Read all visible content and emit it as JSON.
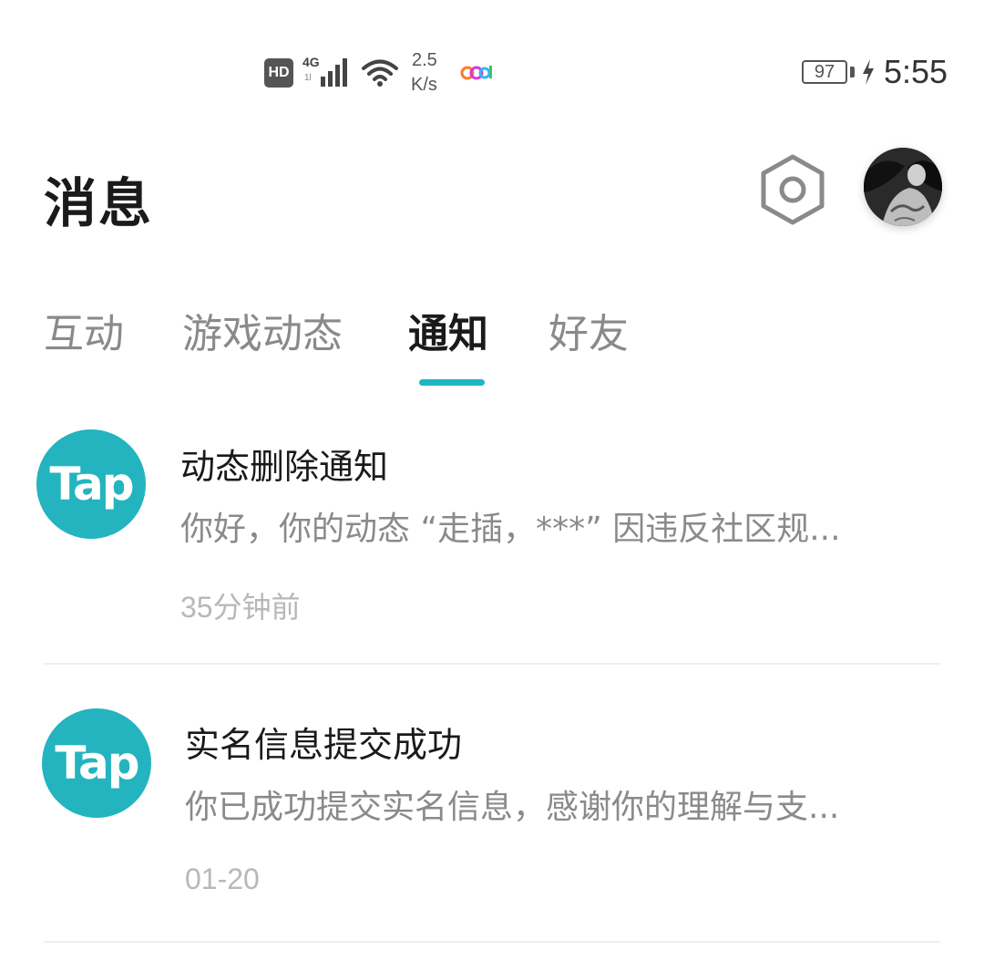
{
  "status_bar": {
    "hd": "HD",
    "network_type": "4G",
    "network_sub": "1l",
    "speed_value": "2.5",
    "speed_unit": "K/s",
    "battery": "97",
    "time": "5:55"
  },
  "header": {
    "title": "消息",
    "settings_icon": "hexagon-settings-icon",
    "avatar_icon": "user-avatar"
  },
  "tabs": [
    {
      "label": "互动",
      "active": false
    },
    {
      "label": "游戏动态",
      "active": false
    },
    {
      "label": "通知",
      "active": true
    },
    {
      "label": "好友",
      "active": false
    }
  ],
  "accent_color": "#1fb5c3",
  "notifications": [
    {
      "avatar_text": "Tap",
      "title": "动态删除通知",
      "body": "你好，你的动态 “走插，***” 因违反社区规...",
      "time": "35分钟前"
    },
    {
      "avatar_text": "Tap",
      "title": "实名信息提交成功",
      "body": "你已成功提交实名信息，感谢你的理解与支...",
      "time": "01-20"
    }
  ]
}
